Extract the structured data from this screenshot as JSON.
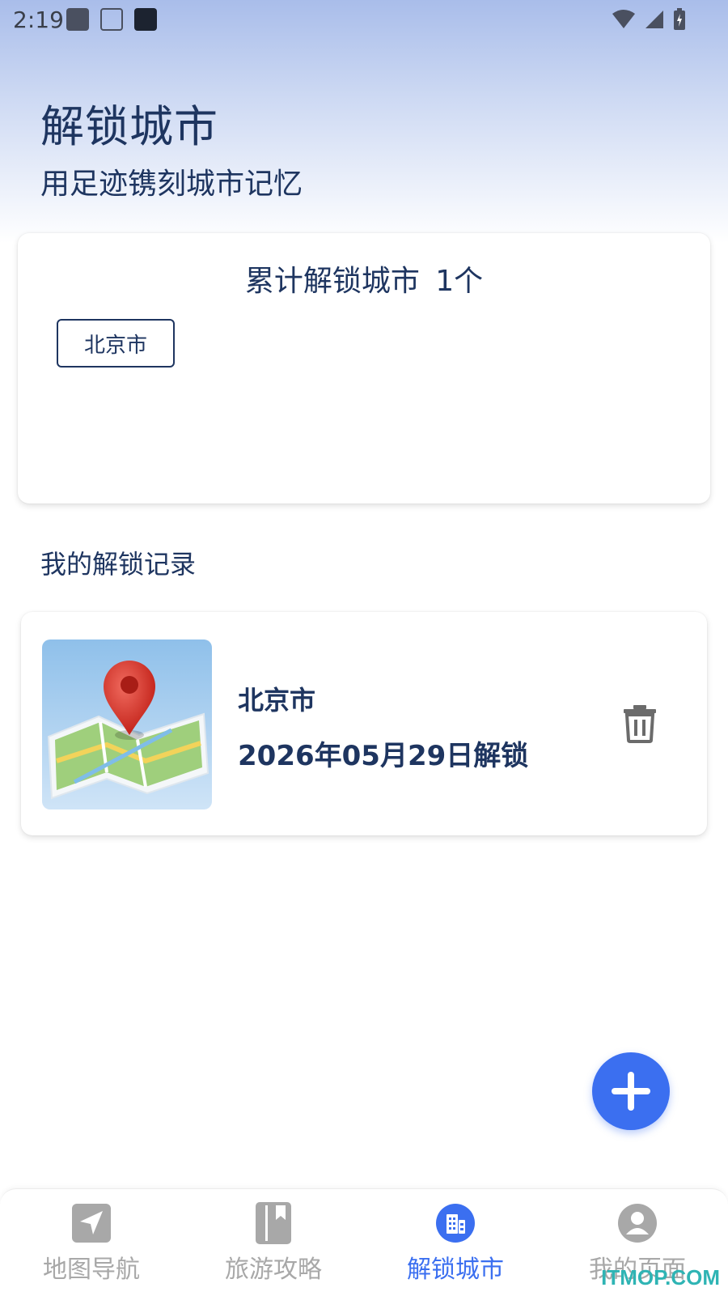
{
  "status_bar": {
    "time": "2:19"
  },
  "header": {
    "title": "解锁城市",
    "subtitle": "用足迹镌刻城市记忆"
  },
  "summary": {
    "label": "累计解锁城市",
    "count": "1个",
    "cities": [
      "北京市"
    ]
  },
  "records_section": {
    "heading": "我的解锁记录",
    "items": [
      {
        "city": "北京市",
        "date": "2026年05月29日解锁"
      }
    ]
  },
  "nav": {
    "items": [
      {
        "label": "地图导航",
        "icon": "navigation-arrow-icon"
      },
      {
        "label": "旅游攻略",
        "icon": "book-icon"
      },
      {
        "label": "解锁城市",
        "icon": "city-buildings-icon"
      },
      {
        "label": "我的页面",
        "icon": "user-icon"
      }
    ],
    "active_index": 2
  },
  "watermark": "ITMOP.COM",
  "colors": {
    "accent": "#3b6ff0",
    "title": "#1e3560",
    "inactive": "#a8a8a8"
  }
}
